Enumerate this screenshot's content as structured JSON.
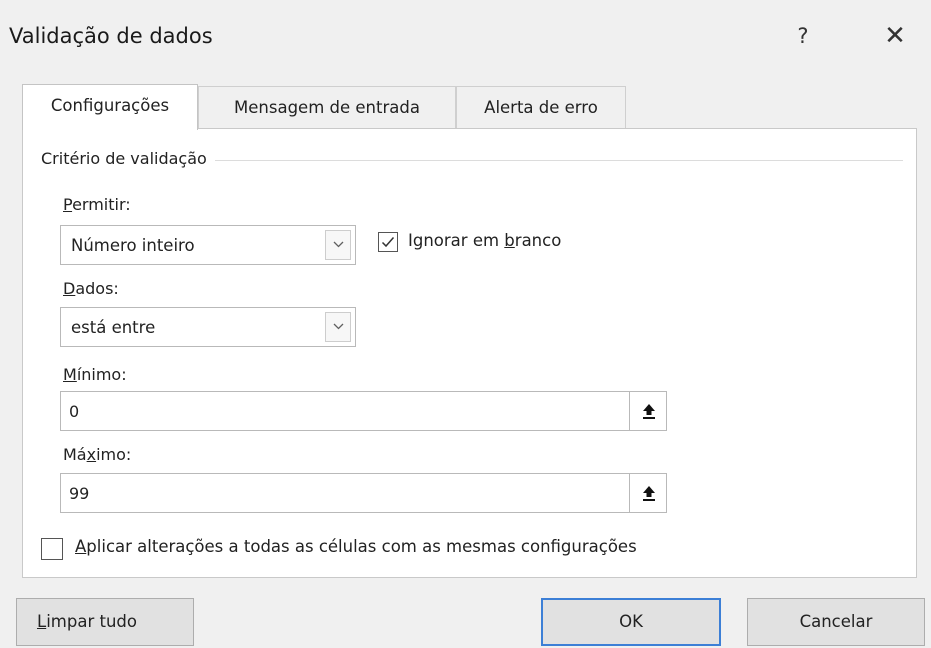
{
  "window": {
    "title": "Validação de dados",
    "help": "?",
    "close": "✕"
  },
  "tabs": [
    {
      "label": "Configurações",
      "active": true
    },
    {
      "label": "Mensagem de entrada",
      "active": false
    },
    {
      "label": "Alerta de erro",
      "active": false
    }
  ],
  "criteria": {
    "group_title": "Critério de validação",
    "allow": {
      "label_first": "P",
      "label_rest": "ermitir:",
      "value": "Número inteiro"
    },
    "ignore_blank": {
      "checked": true,
      "label_pre": "Ignorar em ",
      "label_accel": "b",
      "label_post": "ranco"
    },
    "data": {
      "label_first": "D",
      "label_rest": "ados:",
      "value": "está entre"
    },
    "minimum": {
      "label_first": "M",
      "label_rest": "ínimo:",
      "value": "0"
    },
    "maximum": {
      "label_pre": "Má",
      "label_accel": "x",
      "label_post": "imo:",
      "value": "99"
    }
  },
  "apply_all": {
    "checked": false,
    "label_first": "A",
    "label_rest": "plicar alterações a todas as células com as mesmas configurações"
  },
  "buttons": {
    "clear_first": "L",
    "clear_rest": "impar tudo",
    "ok": "OK",
    "cancel": "Cancelar"
  },
  "colors": {
    "ok_border": "#3c7fd6",
    "panel_bg": "#ffffff",
    "dialog_bg": "#f0f0f0"
  },
  "icons": {
    "dropdown": "chevron-down-icon",
    "collapse": "collapse-dialog-icon",
    "check": "checkmark-icon"
  }
}
